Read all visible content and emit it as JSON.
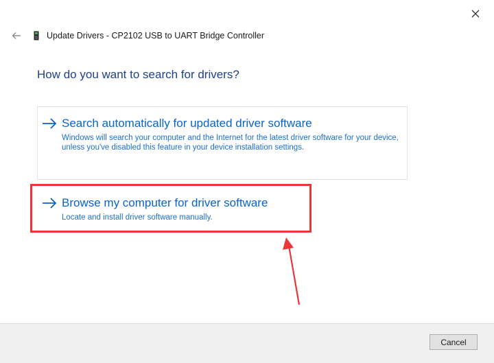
{
  "window": {
    "title": "Update Drivers - CP2102 USB to UART Bridge Controller"
  },
  "main": {
    "heading": "How do you want to search for drivers?",
    "options": [
      {
        "title": "Search automatically for updated driver software",
        "description": "Windows will search your computer and the Internet for the latest driver software for your device, unless you've disabled this feature in your device installation settings."
      },
      {
        "title": "Browse my computer for driver software",
        "description": "Locate and install driver software manually."
      }
    ]
  },
  "footer": {
    "cancel_label": "Cancel"
  },
  "colors": {
    "link_blue": "#0a63c9",
    "heading_blue": "#1f3f8f",
    "annotation_red": "#e8363b",
    "footer_bg": "#f0f0f0"
  },
  "icons": {
    "close": "close-icon",
    "back": "back-arrow-icon",
    "device": "usb-device-icon",
    "option_arrow": "right-arrow-icon"
  }
}
